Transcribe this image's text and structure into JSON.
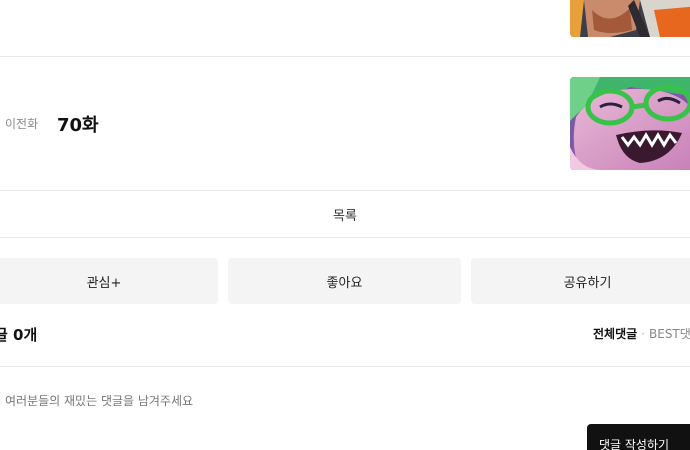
{
  "episode_nav": {
    "previous_label": "이전화",
    "previous_title": "70화"
  },
  "list_link": "목록",
  "actions": {
    "subscribe": "관심+",
    "like": "좋아요",
    "share": "공유하기"
  },
  "comments": {
    "count_label": "글 0개",
    "sort_all": "전체댓글",
    "sort_separator": "·",
    "sort_best": "BEST댓",
    "placeholder": "여러분들의 재밌는 댓글을 남겨주세요",
    "write_button": "댓글 작성하기"
  }
}
